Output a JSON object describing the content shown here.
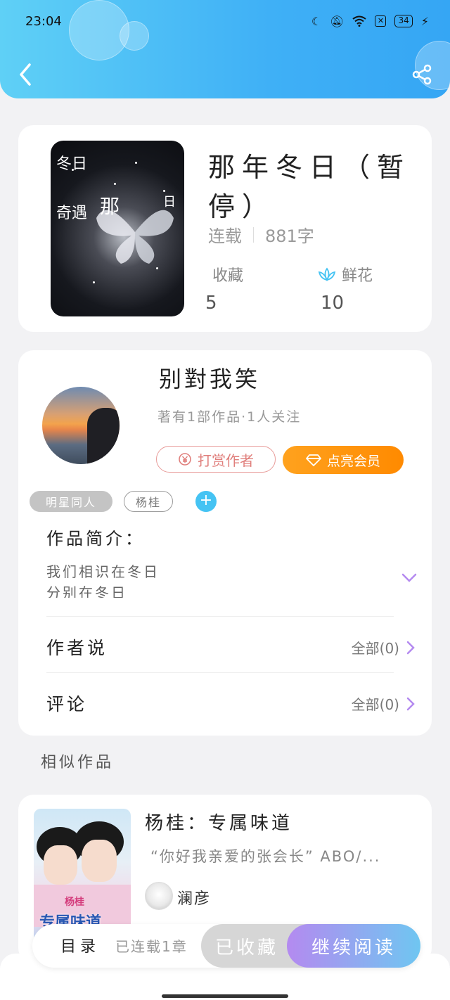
{
  "status": {
    "time": "23:04",
    "battery": "34"
  },
  "book": {
    "title": "那年冬日（暂停）",
    "status": "连载",
    "word_count": "881字",
    "favorites_label": "收藏",
    "favorites": "5",
    "flowers_label": "鲜花",
    "flowers": "10",
    "cover_text_1": "冬日",
    "cover_text_2": "奇遇",
    "cover_text_3": "那",
    "cover_text_4": "日"
  },
  "author": {
    "name": "别對我笑",
    "sub": "著有1部作品·1人关注",
    "reward_label": "打赏作者",
    "vip_label": "点亮会员",
    "tags": [
      "明星同人",
      "杨桂"
    ],
    "add_tag": "+",
    "intro_title": "作品简介：",
    "intro_line1": "我们相识在冬日",
    "intro_line2": "分别在冬日",
    "author_says_label": "作者说",
    "author_says_all": "全部(0)",
    "comments_label": "评论",
    "comments_all": "全部(0)"
  },
  "similar": {
    "section_title": "相似作品",
    "items": [
      {
        "title": "杨桂：专属味道",
        "desc": "“你好我亲爱的张会长” ABO/...",
        "author": "澜彦",
        "cover_text": "专属味道",
        "cover_sub": "杨桂"
      }
    ]
  },
  "bottom": {
    "toc_label": "目录",
    "chapters": "已连载1章",
    "fav_label": "已收藏",
    "read_label": "继续阅读"
  },
  "colors": {
    "header": "#3fb0f6",
    "accent_orange": "#ff8a00",
    "accent_purple": "#b48af0",
    "reward_pink": "#e07f7c"
  }
}
